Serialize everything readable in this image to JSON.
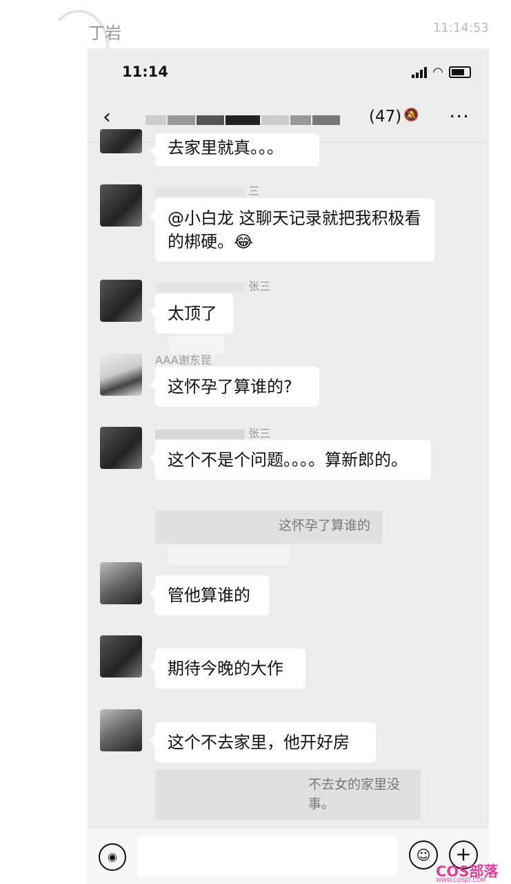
{
  "outer": {
    "title": "丁岩",
    "time": "11:14:53"
  },
  "status_bar": {
    "time": "11:14"
  },
  "nav": {
    "back_icon": "‹",
    "member_count": "(47)",
    "mute_icon": "🔕",
    "more_icon": "···"
  },
  "messages": [
    {
      "sender": "",
      "text": "去家里就真。。。"
    },
    {
      "sender": "三",
      "text": "@小白龙 这聊天记录就把我积极看的梆硬。😂"
    },
    {
      "sender": "张三",
      "text": "太顶了"
    },
    {
      "sender": "AAA谢东昆",
      "text": "这怀孕了算谁的?"
    },
    {
      "sender": "张三",
      "text": "这个不是个问题。。。。算新郎的。",
      "quote": "这怀孕了算谁的"
    },
    {
      "sender": "",
      "text": "管他算谁的"
    },
    {
      "sender": "",
      "text": "期待今晚的大作"
    },
    {
      "sender": "",
      "text": "这个不去家里，他开好房",
      "quote": "不去女的家里没事。"
    }
  ],
  "input": {
    "voice_icon": "◉",
    "emoji_icon": "☺",
    "plus_icon": "+"
  },
  "watermark": {
    "brand": "COS部落",
    "url": "WWW.COSJD.COM"
  }
}
